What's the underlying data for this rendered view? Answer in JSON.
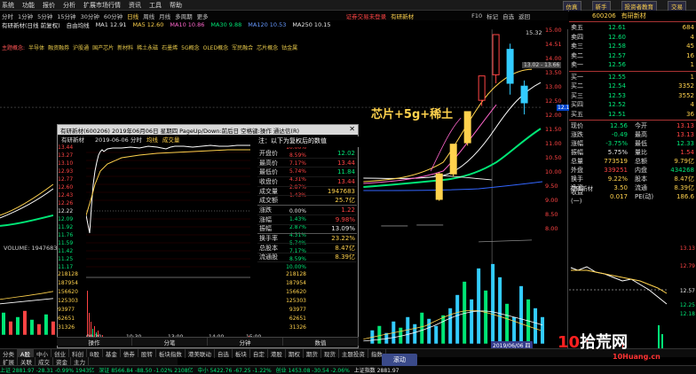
{
  "menubar": {
    "items": [
      "系统",
      "功能",
      "报价",
      "分析",
      "扩展市场行情",
      "资讯",
      "工具",
      "帮助"
    ],
    "right": [
      "仿真",
      "新手",
      "投资者教育",
      "交易"
    ]
  },
  "toolbar": {
    "items": [
      "分时",
      "1分钟",
      "5分钟",
      "15分钟",
      "30分钟",
      "60分钟",
      "日线",
      "周线",
      "月线",
      "多周期",
      "更多"
    ],
    "right_items": [
      "F10",
      "标记",
      "自选",
      "返回"
    ],
    "account_text": "证券交易未登录",
    "stock_name": "有研新材"
  },
  "ma_line": {
    "name": "有研新材(日线 前复权)",
    "mode": "自由均线",
    "ma1": "MA1 12.91",
    "ma5": "MA5 12.60",
    "ma10": "MA10 10.86",
    "ma30": "MA30 9.88",
    "ma120": "MA120 10.53",
    "ma250": "MA250 10.15"
  },
  "concept": {
    "label": "主题概念:",
    "tags": [
      "半导体",
      "融资融券",
      "沪股通",
      "国产芯片",
      "新材料",
      "稀土永磁",
      "石墨烯",
      "5G概念",
      "OLED概念",
      "军民融合",
      "芯片概念",
      "钴金属"
    ]
  },
  "main_chart": {
    "annotation": "芯片+5g+稀土",
    "high_label": "15.32",
    "range_label": "13.02 - 13.66",
    "current_price": "12.10",
    "date_tag": "2019/06/06 四",
    "volume_label": "VOLUME: 1947683",
    "y_ticks": [
      "15.00",
      "14.51",
      "14.00",
      "13.50",
      "13.00",
      "12.50",
      "12.00",
      "11.50",
      "11.00",
      "10.50",
      "10.00",
      "9.50",
      "9.00",
      "8.50",
      "8.00"
    ]
  },
  "chart_data": {
    "type": "candlestick",
    "title": "有研新材(日线 前复权)",
    "series": [
      {
        "name": "MA5",
        "values": [
          9.6,
          9.7,
          9.9,
          10.5,
          11.2,
          12.0,
          12.4,
          12.6
        ]
      },
      {
        "name": "MA10",
        "values": [
          9.5,
          9.6,
          9.7,
          9.9,
          10.2,
          10.6,
          10.8,
          10.86
        ]
      },
      {
        "name": "MA30",
        "values": [
          9.4,
          9.5,
          9.55,
          9.6,
          9.7,
          9.8,
          9.85,
          9.88
        ]
      }
    ],
    "candles": [
      {
        "o": 9.5,
        "c": 10.4,
        "h": 10.45,
        "l": 9.45
      },
      {
        "o": 10.4,
        "c": 11.45,
        "h": 11.45,
        "l": 10.3
      },
      {
        "o": 11.5,
        "c": 12.6,
        "h": 12.6,
        "l": 11.4
      },
      {
        "o": 13.0,
        "c": 13.86,
        "h": 13.86,
        "l": 12.8
      },
      {
        "o": 13.9,
        "c": 15.32,
        "h": 15.32,
        "l": 13.6
      },
      {
        "o": 14.8,
        "c": 13.6,
        "h": 15.0,
        "l": 13.2
      },
      {
        "o": 13.5,
        "c": 12.91,
        "h": 13.7,
        "l": 12.5
      }
    ],
    "ylim": [
      8.0,
      15.5
    ]
  },
  "popup": {
    "title": "有研新材(600206) 2019年06月06日 星期四 PageUp/Down:前后日 空格键:操作 通达信(R)",
    "sub": "有研新材",
    "sub_date": "2019-06-06 分时",
    "sub_mode": "均线",
    "sub_mode2": "成交量",
    "y_left": [
      "13.44",
      "13.27",
      "13.10",
      "12.93",
      "12.77",
      "12.60",
      "12.43",
      "12.26",
      "12.22",
      "12.09",
      "11.92",
      "11.76",
      "11.59",
      "11.42",
      "11.25",
      "11.17"
    ],
    "y_right": [
      "10.00%",
      "8.59%",
      "7.17%",
      "5.74%",
      "4.31%",
      "2.87%",
      "1.43%",
      "0.00%",
      "1.43%",
      "2.87%",
      "4.31%",
      "5.74%",
      "7.17%",
      "8.59%",
      "10.00%"
    ],
    "vol_left": [
      "218128",
      "187954",
      "156620",
      "125303",
      "93977",
      "62651",
      "31326"
    ],
    "x_ticks": [
      "09:30",
      "10:30",
      "13:00",
      "14:00",
      "15:00"
    ],
    "info_head": "注：以下为复权后的数值",
    "info": [
      {
        "k": "开盘价",
        "v": "12.02",
        "cls": "grn"
      },
      {
        "k": "最高价",
        "v": "13.44",
        "cls": "red"
      },
      {
        "k": "最低价",
        "v": "11.84",
        "cls": "grn"
      },
      {
        "k": "收盘价",
        "v": "13.44",
        "cls": "red"
      },
      {
        "k": "成交量",
        "v": "1947683",
        "cls": "yel"
      },
      {
        "k": "成交额",
        "v": "25.7亿",
        "cls": "yel"
      },
      {
        "k": "涨跌",
        "v": "1.22",
        "cls": "red"
      },
      {
        "k": "涨幅",
        "v": "9.98%",
        "cls": "red"
      },
      {
        "k": "振幅",
        "v": "13.09%",
        "cls": "wht"
      },
      {
        "k": "换手率",
        "v": "23.22%",
        "cls": "yel"
      },
      {
        "k": "总股本",
        "v": "8.47亿",
        "cls": "yel"
      },
      {
        "k": "流通股",
        "v": "8.39亿",
        "cls": "yel"
      }
    ],
    "tabs": [
      "操作",
      "分笔",
      "分钟",
      "数值"
    ]
  },
  "right_panel": {
    "code": "600206",
    "name": "有研新材",
    "sells": [
      {
        "lbl": "卖五",
        "px": "12.61",
        "qty": "684"
      },
      {
        "lbl": "卖四",
        "px": "12.60",
        "qty": "4"
      },
      {
        "lbl": "卖三",
        "px": "12.58",
        "qty": "45"
      },
      {
        "lbl": "卖二",
        "px": "12.57",
        "qty": "16"
      },
      {
        "lbl": "卖一",
        "px": "12.56",
        "qty": "1"
      }
    ],
    "buys": [
      {
        "lbl": "买一",
        "px": "12.55",
        "qty": "1"
      },
      {
        "lbl": "买二",
        "px": "12.54",
        "qty": "3352"
      },
      {
        "lbl": "买三",
        "px": "12.53",
        "qty": "3552"
      },
      {
        "lbl": "买四",
        "px": "12.52",
        "qty": "4"
      },
      {
        "lbl": "买五",
        "px": "12.51",
        "qty": "36"
      }
    ],
    "stats": [
      {
        "k": "现价",
        "v": "12.56",
        "vc": "grn",
        "k2": "今开",
        "v2": "13.13",
        "v2c": "red"
      },
      {
        "k": "涨跌",
        "v": "-0.49",
        "vc": "grn",
        "k2": "最高",
        "v2": "13.13",
        "v2c": "red"
      },
      {
        "k": "涨幅",
        "v": "-3.75%",
        "vc": "grn",
        "k2": "最低",
        "v2": "12.33",
        "v2c": "grn"
      },
      {
        "k": "振幅",
        "v": "5.75%",
        "vc": "wht",
        "k2": "量比",
        "v2": "1.54",
        "v2c": "red"
      },
      {
        "k": "总量",
        "v": "773519",
        "vc": "yel",
        "k2": "总额",
        "v2": "9.79亿",
        "v2c": "yel"
      },
      {
        "k": "外盘",
        "v": "339251",
        "vc": "red",
        "k2": "内盘",
        "v2": "434268",
        "v2c": "grn"
      },
      {
        "k": "换手",
        "v": "9.22%",
        "vc": "yel",
        "k2": "股本",
        "v2": "8.47亿",
        "v2c": "yel"
      },
      {
        "k": "净资",
        "v": "3.50",
        "vc": "yel",
        "k2": "流通",
        "v2": "8.39亿",
        "v2c": "yel"
      },
      {
        "k": "收益(一)",
        "v": "0.017",
        "vc": "yel",
        "k2": "PE(动)",
        "v2": "186.6",
        "v2c": "yel"
      }
    ],
    "mini_label": "有研新材",
    "mini_ticks": [
      "13.13",
      "12.79",
      "12.57",
      "12.25",
      "12.18"
    ]
  },
  "bottom_tabs": [
    "分类",
    "A股",
    "中小",
    "创业",
    "科创",
    "B股",
    "基金",
    "债券",
    "股转",
    "板块指数",
    "港美联动",
    "自选",
    "板块",
    "自定",
    "港股",
    "期权",
    "期货",
    "现货",
    "主题投资",
    "指数"
  ],
  "bottom_tabs2": [
    "扩展",
    "关联",
    "成交",
    "资金",
    "主力"
  ],
  "statusbar": [
    {
      "t": "上证 2881.97 -28.31 -0.99% 1943亿",
      "c": "grn"
    },
    {
      "t": "深证 8566.84 -88.50 -1.02% 2108亿",
      "c": "grn"
    },
    {
      "t": "中小 5422.76 -67.25 -1.22%",
      "c": "grn"
    },
    {
      "t": "创业 1453.08 -30.54 -2.06%",
      "c": "grn"
    },
    {
      "t": "上证指数 2881.97",
      "c": "wht"
    }
  ],
  "feed_button": "滚动",
  "watermark": {
    "num": "10",
    "cn": "拾荒网",
    "url": "10Huang.cn"
  }
}
